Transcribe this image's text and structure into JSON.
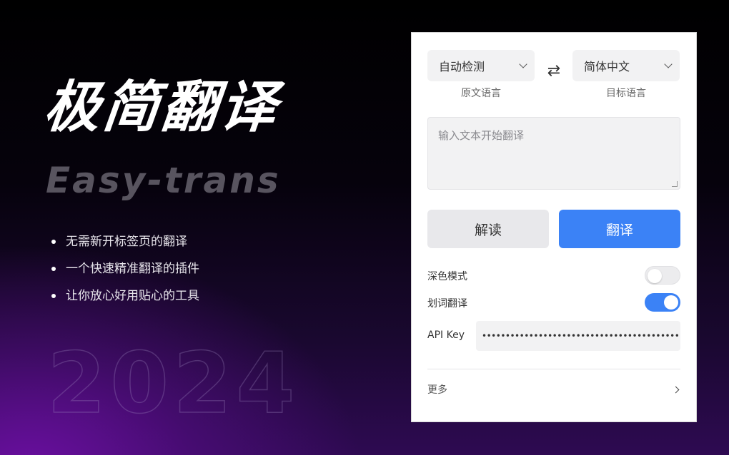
{
  "hero": {
    "title": "极简翻译",
    "subtitle": "Easy-trans",
    "bullets": [
      "无需新开标签页的翻译",
      "一个快速精准翻译的插件",
      "让你放心好用贴心的工具"
    ],
    "year": "2024"
  },
  "panel": {
    "source_lang": {
      "value": "自动检测",
      "caption": "原文语言"
    },
    "swap_icon": "⇄",
    "target_lang": {
      "value": "简体中文",
      "caption": "目标语言"
    },
    "input": {
      "placeholder": "输入文本开始翻译"
    },
    "buttons": {
      "explain": "解读",
      "translate": "翻译"
    },
    "dark_mode": {
      "label": "深色模式",
      "on": false
    },
    "word_select": {
      "label": "划词翻译",
      "on": true
    },
    "api_key": {
      "label": "API Key",
      "value": "••••••••••••••••••••••••••••••••••••••••••••••••"
    },
    "more": {
      "label": "更多"
    }
  },
  "colors": {
    "accent": "#3b82f6",
    "toggle_off": "#ececee",
    "panel_bg": "#ffffff"
  },
  "icons": {
    "swap": "swap-arrows-icon",
    "dropdown": "chevron-down-icon",
    "more": "chevron-right-icon"
  }
}
